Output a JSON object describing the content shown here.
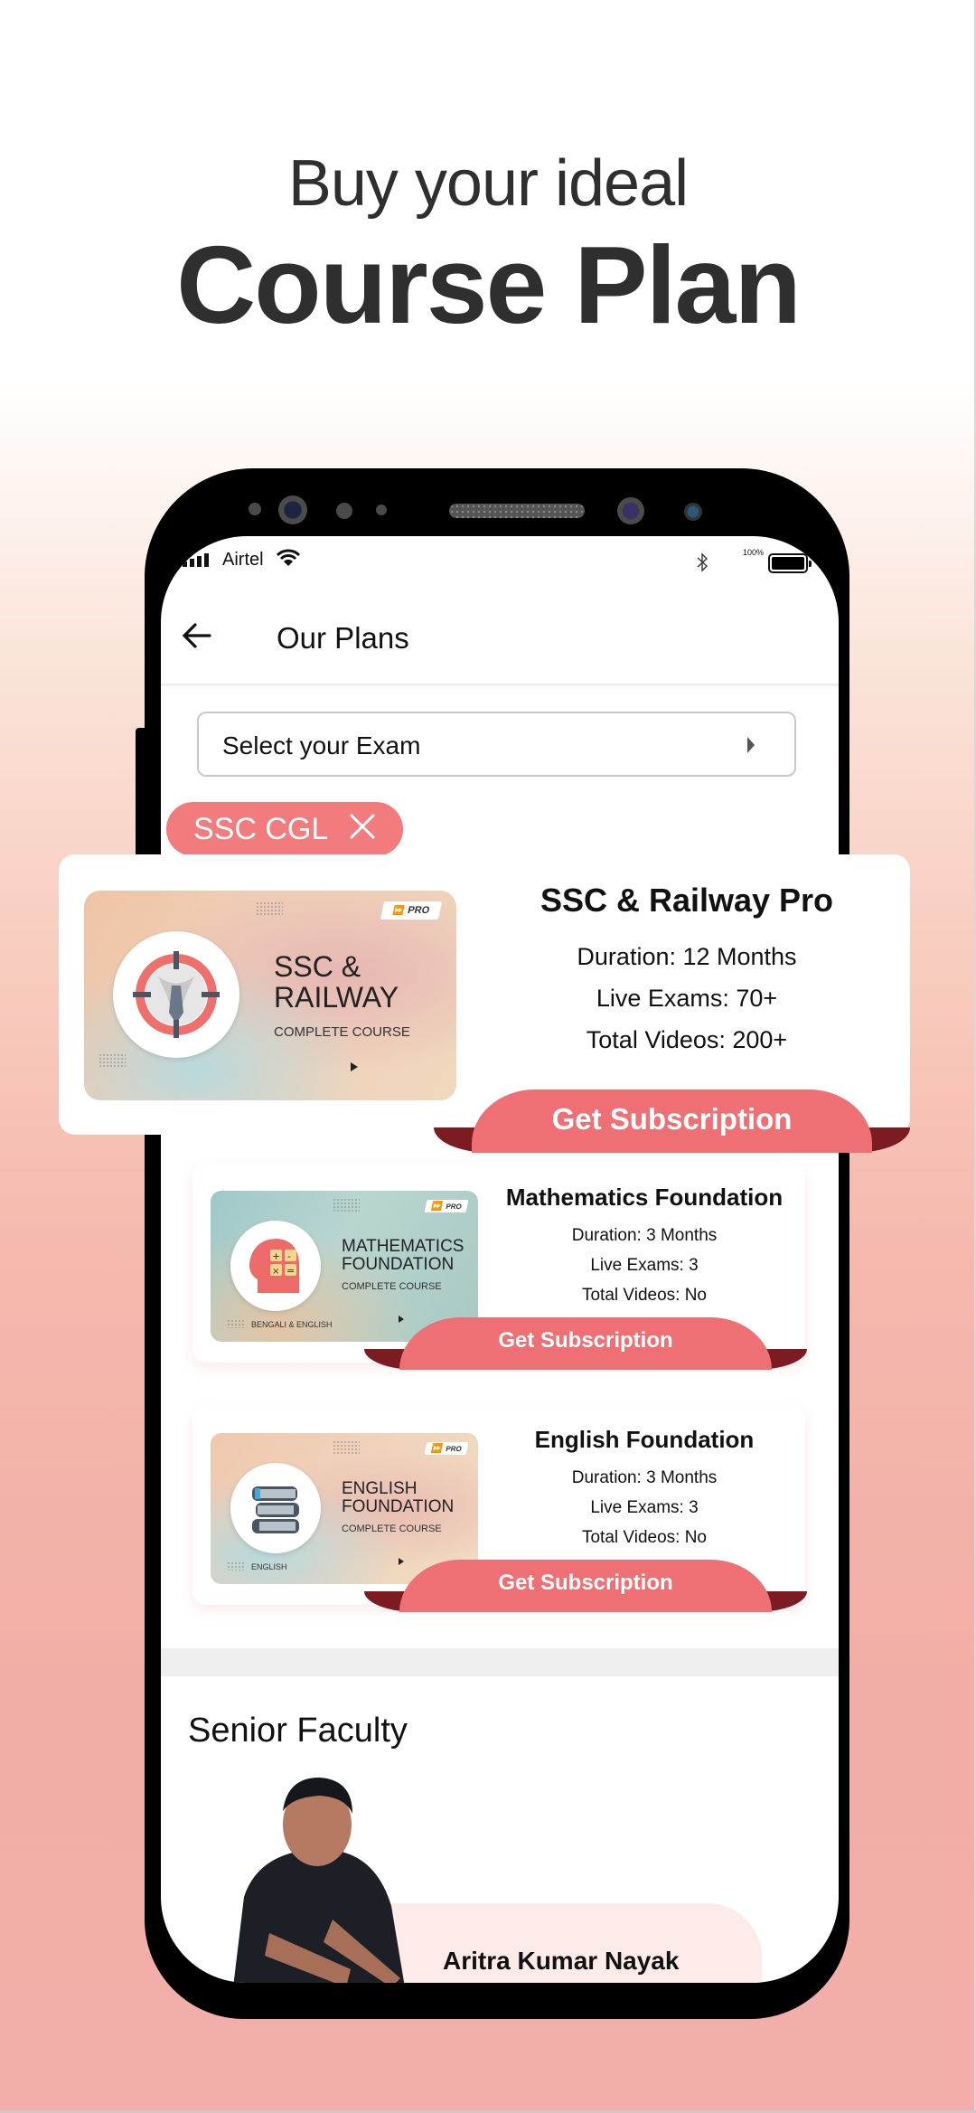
{
  "promo": {
    "headline_sub": "Buy your ideal",
    "headline_main": "Course Plan"
  },
  "status_bar": {
    "carrier": "Airtel",
    "battery_percent": "100%",
    "icons": [
      "signal-icon",
      "wifi-icon",
      "bluetooth-icon",
      "battery-icon"
    ]
  },
  "app_bar": {
    "title": "Our Plans",
    "back_icon": "arrow-left-icon"
  },
  "exam_select": {
    "placeholder": "Select your Exam",
    "icon": "caret-right-icon"
  },
  "filter_chip": {
    "label": "SSC CGL",
    "close_icon": "close-icon"
  },
  "colors": {
    "accent": "#ee6f74",
    "chip": "#f27b7e",
    "ribbon_dark": "#7c1c22",
    "text": "#111111",
    "headline": "#2f2f2f"
  },
  "plans": [
    {
      "title": "SSC & Railway Pro",
      "duration": "Duration: 12 Months",
      "live_exams": "Live Exams: 70+",
      "total_videos": "Total Videos: 200+",
      "button": "Get Subscription",
      "thumbnail": {
        "badge": "PRO",
        "title_line1": "SSC &",
        "title_line2": "RAILWAY",
        "subtitle": "COMPLETE COURSE",
        "language": "",
        "icon": "target-tie-icon"
      }
    },
    {
      "title": "Mathematics Foundation",
      "duration": "Duration: 3 Months",
      "live_exams": "Live Exams: 3",
      "total_videos": "Total Videos: No",
      "button": "Get Subscription",
      "thumbnail": {
        "badge": "PRO",
        "title_line1": "MATHEMATICS",
        "title_line2": "FOUNDATION",
        "subtitle": "COMPLETE COURSE",
        "language": "BENGALI & ENGLISH",
        "icon": "head-calculator-icon"
      }
    },
    {
      "title": "English Foundation",
      "duration": "Duration: 3 Months",
      "live_exams": "Live Exams: 3",
      "total_videos": "Total Videos: No",
      "button": "Get Subscription",
      "thumbnail": {
        "badge": "PRO",
        "title_line1": "ENGLISH",
        "title_line2": "FOUNDATION",
        "subtitle": "COMPLETE COURSE",
        "language": "ENGLISH",
        "icon": "books-icon"
      }
    }
  ],
  "faculty": {
    "section_title": "Senior Faculty",
    "members": [
      {
        "name": "Aritra Kumar Nayak"
      }
    ]
  }
}
